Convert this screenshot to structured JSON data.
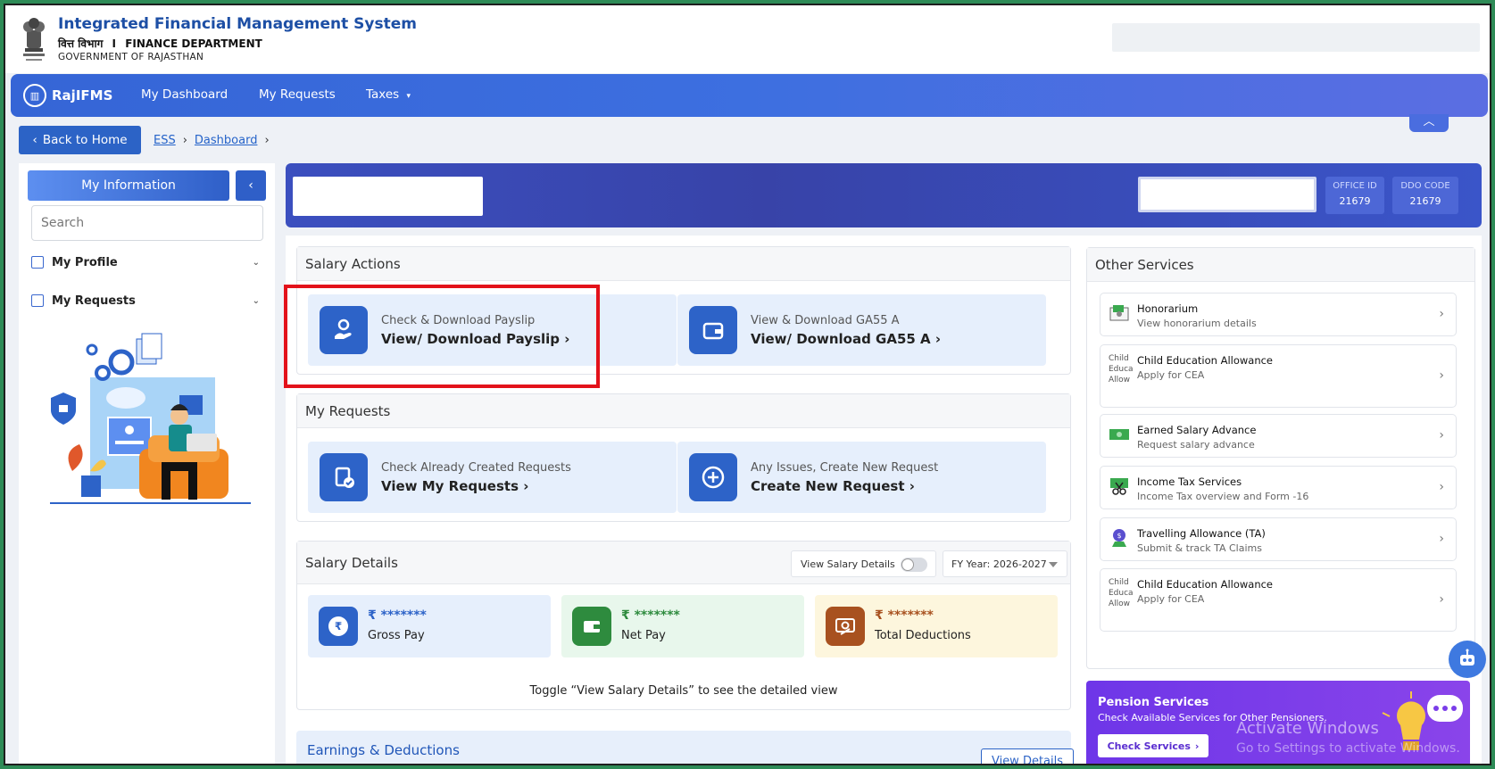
{
  "header": {
    "title": "Integrated Financial Management System",
    "dept_hindi": "वित्त विभाग",
    "dept_sep": "I",
    "dept_english": "FINANCE DEPARTMENT",
    "govt": "GOVERNMENT OF RAJASTHAN"
  },
  "nav": {
    "logo": "RajIFMS",
    "items": [
      "My Dashboard",
      "My Requests",
      "Taxes"
    ],
    "collapse_icon": "chevron-up-icon"
  },
  "breadcrumb": {
    "back_label": "Back to Home",
    "items": [
      "ESS",
      "Dashboard"
    ]
  },
  "sidebar": {
    "title": "My Information",
    "search_placeholder": "Search",
    "items": [
      {
        "label": "My Profile"
      },
      {
        "label": "My Requests"
      }
    ]
  },
  "banner": {
    "office_id_label": "OFFICE ID",
    "office_id": "21679",
    "ddo_code_label": "DDO CODE",
    "ddo_code": "21679"
  },
  "salary_actions": {
    "title": "Salary Actions",
    "cards": [
      {
        "sub": "Check & Download Payslip",
        "main": "View/ Download Payslip"
      },
      {
        "sub": "View & Download GA55 A",
        "main": "View/ Download GA55 A"
      }
    ]
  },
  "my_requests": {
    "title": "My Requests",
    "cards": [
      {
        "sub": "Check Already Created Requests",
        "main": "View My Requests"
      },
      {
        "sub": "Any Issues, Create New Request",
        "main": "Create New Request"
      }
    ]
  },
  "salary_details": {
    "title": "Salary Details",
    "toggle_label": "View Salary Details",
    "fy_label": "FY Year: 2026-2027",
    "cards": [
      {
        "value": "₹ *******",
        "label": "Gross Pay",
        "color": "#2d63c8"
      },
      {
        "value": "₹ *******",
        "label": "Net Pay",
        "color": "#2e8b3e"
      },
      {
        "value": "₹ *******",
        "label": "Total Deductions",
        "color": "#a8511f"
      }
    ],
    "hint": "Toggle “View Salary Details” to see the detailed view"
  },
  "earnings": {
    "title": "Earnings & Deductions",
    "button": "View Details"
  },
  "other_services": {
    "title": "Other Services",
    "items": [
      {
        "title": "Honorarium",
        "sub": "View honorarium details",
        "broken": ""
      },
      {
        "title": "Child Education Allowance",
        "sub": "Apply for CEA",
        "broken": "Child Educa Allow"
      },
      {
        "title": "Earned Salary Advance",
        "sub": "Request salary advance",
        "broken": ""
      },
      {
        "title": "Income Tax Services",
        "sub": "Income Tax overview and Form -16",
        "broken": ""
      },
      {
        "title": "Travelling Allowance (TA)",
        "sub": "Submit & track TA Claims",
        "broken": ""
      },
      {
        "title": "Child Education Allowance",
        "sub": "Apply for CEA",
        "broken": "Child Educa Allow"
      }
    ]
  },
  "pension": {
    "title": "Pension Services",
    "sub": "Check Available Services for Other Pensioners.",
    "button": "Check Services",
    "watermark_line1": "Activate Windows",
    "watermark_line2": "Go to Settings to activate Windows."
  },
  "colors": {
    "primary": "#2c63c6",
    "nav": "#3d6fe0",
    "highlight": "#e3121a",
    "pension": "#7a3de9"
  }
}
